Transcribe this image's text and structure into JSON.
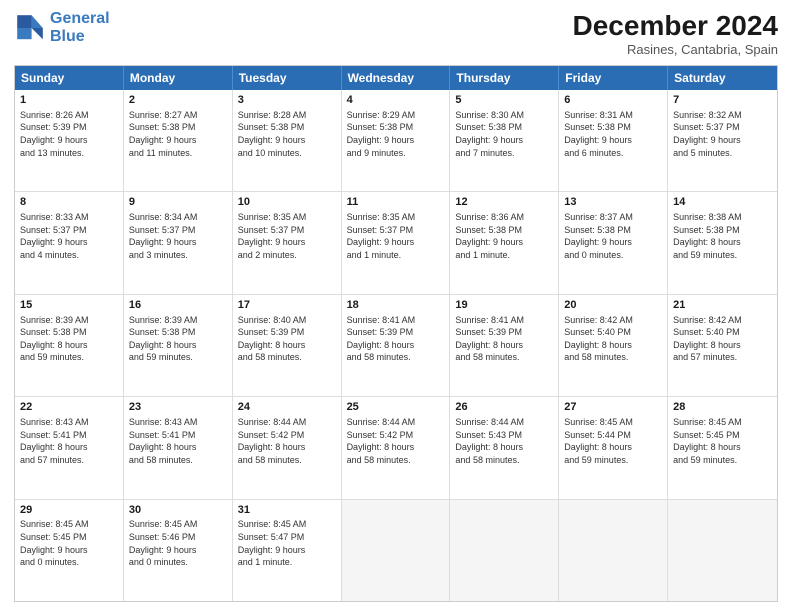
{
  "header": {
    "logo_line1": "General",
    "logo_line2": "Blue",
    "month_year": "December 2024",
    "location": "Rasines, Cantabria, Spain"
  },
  "days_of_week": [
    "Sunday",
    "Monday",
    "Tuesday",
    "Wednesday",
    "Thursday",
    "Friday",
    "Saturday"
  ],
  "weeks": [
    [
      {
        "day": "1",
        "info": "Sunrise: 8:26 AM\nSunset: 5:39 PM\nDaylight: 9 hours\nand 13 minutes."
      },
      {
        "day": "2",
        "info": "Sunrise: 8:27 AM\nSunset: 5:38 PM\nDaylight: 9 hours\nand 11 minutes."
      },
      {
        "day": "3",
        "info": "Sunrise: 8:28 AM\nSunset: 5:38 PM\nDaylight: 9 hours\nand 10 minutes."
      },
      {
        "day": "4",
        "info": "Sunrise: 8:29 AM\nSunset: 5:38 PM\nDaylight: 9 hours\nand 9 minutes."
      },
      {
        "day": "5",
        "info": "Sunrise: 8:30 AM\nSunset: 5:38 PM\nDaylight: 9 hours\nand 7 minutes."
      },
      {
        "day": "6",
        "info": "Sunrise: 8:31 AM\nSunset: 5:38 PM\nDaylight: 9 hours\nand 6 minutes."
      },
      {
        "day": "7",
        "info": "Sunrise: 8:32 AM\nSunset: 5:37 PM\nDaylight: 9 hours\nand 5 minutes."
      }
    ],
    [
      {
        "day": "8",
        "info": "Sunrise: 8:33 AM\nSunset: 5:37 PM\nDaylight: 9 hours\nand 4 minutes."
      },
      {
        "day": "9",
        "info": "Sunrise: 8:34 AM\nSunset: 5:37 PM\nDaylight: 9 hours\nand 3 minutes."
      },
      {
        "day": "10",
        "info": "Sunrise: 8:35 AM\nSunset: 5:37 PM\nDaylight: 9 hours\nand 2 minutes."
      },
      {
        "day": "11",
        "info": "Sunrise: 8:35 AM\nSunset: 5:37 PM\nDaylight: 9 hours\nand 1 minute."
      },
      {
        "day": "12",
        "info": "Sunrise: 8:36 AM\nSunset: 5:38 PM\nDaylight: 9 hours\nand 1 minute."
      },
      {
        "day": "13",
        "info": "Sunrise: 8:37 AM\nSunset: 5:38 PM\nDaylight: 9 hours\nand 0 minutes."
      },
      {
        "day": "14",
        "info": "Sunrise: 8:38 AM\nSunset: 5:38 PM\nDaylight: 8 hours\nand 59 minutes."
      }
    ],
    [
      {
        "day": "15",
        "info": "Sunrise: 8:39 AM\nSunset: 5:38 PM\nDaylight: 8 hours\nand 59 minutes."
      },
      {
        "day": "16",
        "info": "Sunrise: 8:39 AM\nSunset: 5:38 PM\nDaylight: 8 hours\nand 59 minutes."
      },
      {
        "day": "17",
        "info": "Sunrise: 8:40 AM\nSunset: 5:39 PM\nDaylight: 8 hours\nand 58 minutes."
      },
      {
        "day": "18",
        "info": "Sunrise: 8:41 AM\nSunset: 5:39 PM\nDaylight: 8 hours\nand 58 minutes."
      },
      {
        "day": "19",
        "info": "Sunrise: 8:41 AM\nSunset: 5:39 PM\nDaylight: 8 hours\nand 58 minutes."
      },
      {
        "day": "20",
        "info": "Sunrise: 8:42 AM\nSunset: 5:40 PM\nDaylight: 8 hours\nand 58 minutes."
      },
      {
        "day": "21",
        "info": "Sunrise: 8:42 AM\nSunset: 5:40 PM\nDaylight: 8 hours\nand 57 minutes."
      }
    ],
    [
      {
        "day": "22",
        "info": "Sunrise: 8:43 AM\nSunset: 5:41 PM\nDaylight: 8 hours\nand 57 minutes."
      },
      {
        "day": "23",
        "info": "Sunrise: 8:43 AM\nSunset: 5:41 PM\nDaylight: 8 hours\nand 58 minutes."
      },
      {
        "day": "24",
        "info": "Sunrise: 8:44 AM\nSunset: 5:42 PM\nDaylight: 8 hours\nand 58 minutes."
      },
      {
        "day": "25",
        "info": "Sunrise: 8:44 AM\nSunset: 5:42 PM\nDaylight: 8 hours\nand 58 minutes."
      },
      {
        "day": "26",
        "info": "Sunrise: 8:44 AM\nSunset: 5:43 PM\nDaylight: 8 hours\nand 58 minutes."
      },
      {
        "day": "27",
        "info": "Sunrise: 8:45 AM\nSunset: 5:44 PM\nDaylight: 8 hours\nand 59 minutes."
      },
      {
        "day": "28",
        "info": "Sunrise: 8:45 AM\nSunset: 5:45 PM\nDaylight: 8 hours\nand 59 minutes."
      }
    ],
    [
      {
        "day": "29",
        "info": "Sunrise: 8:45 AM\nSunset: 5:45 PM\nDaylight: 9 hours\nand 0 minutes."
      },
      {
        "day": "30",
        "info": "Sunrise: 8:45 AM\nSunset: 5:46 PM\nDaylight: 9 hours\nand 0 minutes."
      },
      {
        "day": "31",
        "info": "Sunrise: 8:45 AM\nSunset: 5:47 PM\nDaylight: 9 hours\nand 1 minute."
      },
      {
        "day": "",
        "info": ""
      },
      {
        "day": "",
        "info": ""
      },
      {
        "day": "",
        "info": ""
      },
      {
        "day": "",
        "info": ""
      }
    ]
  ]
}
